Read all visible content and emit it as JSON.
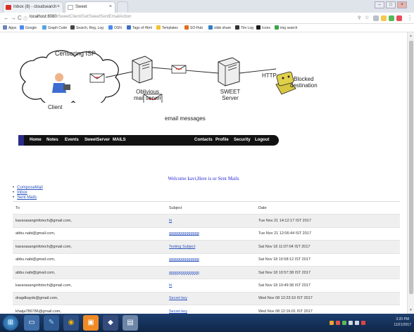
{
  "browser": {
    "tabs": [
      {
        "title": "Inbox (8) - cloudsearch"
      },
      {
        "title": "Sweet"
      }
    ],
    "url_host": "localhost:8080",
    "url_path": "/SweetClient/GetSweetSentEmailAction",
    "bookmarks": [
      "Apps",
      "Google",
      "Graph Code",
      "Search, Reg, Log",
      "OSN",
      "Tags of Html",
      "Templates",
      "SO-Hub",
      "slide share",
      "Tim Log",
      "Icons",
      "img search"
    ]
  },
  "diagram": {
    "censoring_isp": "Censoring ISP",
    "client": "Client",
    "oblivious_server_l1": "Oblivious",
    "oblivious_server_l2": "mail server",
    "sweet_server_l1": "SWEET",
    "sweet_server_l2": "Server",
    "http": "HTTP",
    "blocked_l1": "Blocked",
    "blocked_l2": "destination",
    "email_messages": "email messages"
  },
  "nav": {
    "items": [
      "Home",
      "Notes",
      "Events",
      "SweetServer",
      "MAILS",
      "Contacts",
      "Profile",
      "Security",
      "Logout"
    ]
  },
  "welcome": "Welcome kavi,Here is ur Sent Mails",
  "side_links": [
    "ComposeMail",
    "Inbox",
    "Sent Mails"
  ],
  "table": {
    "headers": [
      "To",
      "Subject",
      "Date"
    ],
    "rows": [
      {
        "to": "kavarasanginfotech@gmail.com,",
        "subject": "hi",
        "date": "Tue Nov 21 14:12:17 IST 2017"
      },
      {
        "to": "abbu.nabi@gmail.com,",
        "subject": "gggggggggggggg",
        "date": "Tue Nov 21 12:06:44 IST 2017"
      },
      {
        "to": "kavarasanginfotech@gmail.com,",
        "subject": "Testing Subject",
        "date": "Sat Nov 18 11:07:04 IST 2017"
      },
      {
        "to": "abbu.nabi@gmail.com,",
        "subject": "gggggggggggggg",
        "date": "Sat Nov 18 10:58:12 IST 2017"
      },
      {
        "to": "abbu.nabi@gmail.com,",
        "subject": "gggggggggggggg",
        "date": "Sat Nov 18 10:57:38 IST 2017"
      },
      {
        "to": "kavarasanginfotech@gmail.com,",
        "subject": "hi",
        "date": "Sat Nov 18 10:49:38 IST 2017"
      },
      {
        "to": "dragdkayds@gmail.com,",
        "subject": "Secret key",
        "date": "Wed Nov 08 12:23:10 IST 2017"
      },
      {
        "to": "khaija786786@gmail.com,",
        "subject": "Secret key",
        "date": "Wed Nov 08 12:16:01 IST 2017"
      }
    ]
  },
  "taskbar": {
    "time": "3:20 PM",
    "date": "11/21/2017"
  }
}
